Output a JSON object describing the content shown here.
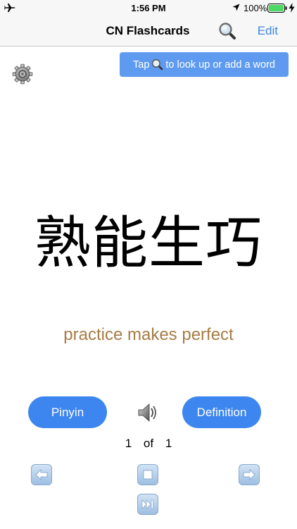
{
  "status_bar": {
    "time": "1:56 PM",
    "battery_percent": "100%",
    "icons": [
      "airplane-icon",
      "location-icon",
      "battery-icon",
      "charging-icon"
    ]
  },
  "nav": {
    "title": "CN Flashcards",
    "edit_label": "Edit",
    "search_icon": "magnifying-glass-icon"
  },
  "tip": {
    "prefix": "Tap",
    "suffix": "to look up or add a word"
  },
  "card": {
    "word": "熟能生巧",
    "translation": "practice makes perfect"
  },
  "buttons": {
    "pinyin_label": "Pinyin",
    "definition_label": "Definition"
  },
  "counter": {
    "current": "1",
    "separator": "of",
    "total": "1"
  },
  "colors": {
    "accent": "#3d86f0",
    "banner": "#5e9bf0",
    "translation": "#a67c45",
    "edit": "#3d86e6"
  }
}
